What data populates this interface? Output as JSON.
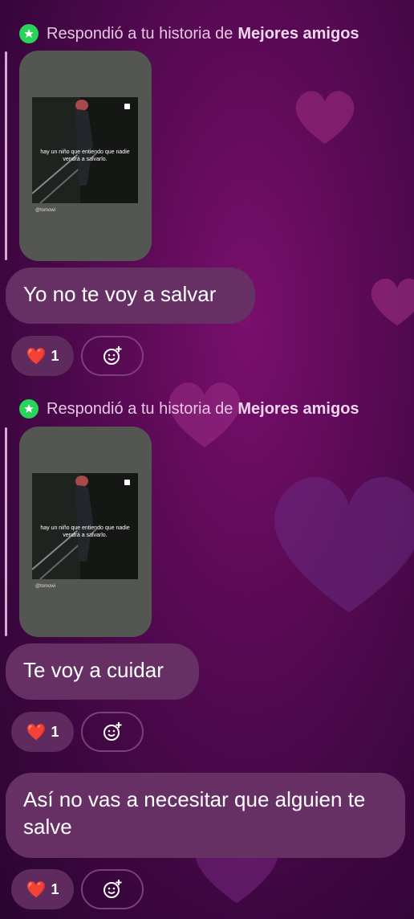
{
  "messages": [
    {
      "reply_prefix": "Respondió a tu historia de",
      "reply_audience": "Mejores amigos",
      "story_caption": "hay un niño que entiendo que nadie vendrá a salvarlo.",
      "story_handle": "@tomowi",
      "text": "Yo no te voy a salvar",
      "reaction_emoji": "❤️",
      "reaction_count": "1"
    },
    {
      "reply_prefix": "Respondió a tu historia de",
      "reply_audience": "Mejores amigos",
      "story_caption": "hay un niño que entiendo que nadie vendrá a salvarlo.",
      "story_handle": "@tomowi",
      "text": "Te voy a cuidar",
      "reaction_emoji": "❤️",
      "reaction_count": "1"
    },
    {
      "text": "Así no vas a necesitar que alguien te salve",
      "reaction_emoji": "❤️",
      "reaction_count": "1"
    }
  ],
  "icons": {
    "star_badge": "star-icon",
    "add_reaction": "add-reaction-icon",
    "reaction": "heart-icon"
  },
  "colors": {
    "star_badge": "#2ad35a",
    "bubble": "#673065",
    "story_card": "#545651"
  }
}
